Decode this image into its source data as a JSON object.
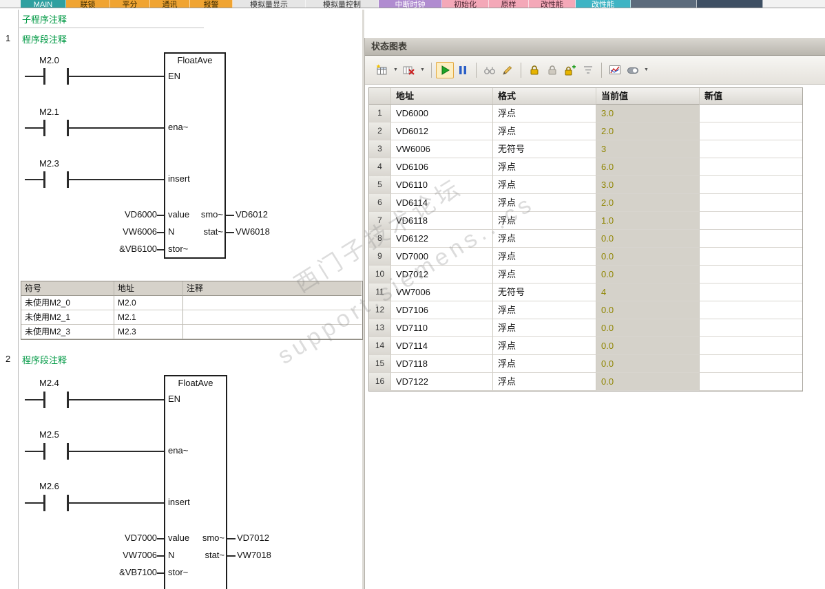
{
  "top_tabs": {
    "items": [
      {
        "label": "MAIN",
        "color": "#2fa0a0"
      },
      {
        "label": "联锁",
        "color": "#f0a432"
      },
      {
        "label": "平分",
        "color": "#f0a432"
      },
      {
        "label": "通讯",
        "color": "#f0a432"
      },
      {
        "label": "报警",
        "color": "#f0a432"
      },
      {
        "label": "模拟量显示",
        "color": "#e6e6e6"
      },
      {
        "label": "模拟量控制",
        "color": "#e6e6e6"
      },
      {
        "label": "中断时钟",
        "color": "#b08cd0"
      },
      {
        "label": "初始化",
        "color": "#f4a8b8"
      },
      {
        "label": "原样",
        "color": "#f4a8b8"
      },
      {
        "label": "改性能",
        "color": "#f4a8b8"
      },
      {
        "label": "改性能",
        "color": "#3fb4c4"
      },
      {
        "label": "",
        "color": "#5c6b7c"
      },
      {
        "label": "",
        "color": "#3e4f63"
      }
    ]
  },
  "editor": {
    "subroutine_comment": "子程序注释",
    "networks": [
      {
        "number": "1",
        "comment": "程序段注释",
        "contacts": [
          "M2.0",
          "M2.1",
          "M2.3"
        ],
        "block": {
          "title": "FloatAve",
          "pin_en": "EN",
          "pin_ena": "ena~",
          "pin_insert": "insert",
          "pin_value": "value",
          "pin_n": "N",
          "pin_stor": "stor~",
          "pin_smo": "smo~",
          "pin_stat": "stat~",
          "op_value": "VD6000",
          "op_n": "VW6006",
          "op_stor": "&VB6100",
          "op_smo": "VD6012",
          "op_stat": "VW6018"
        },
        "symbol_table": {
          "headers": [
            "符号",
            "地址",
            "注释"
          ],
          "rows": [
            {
              "symbol": "未使用M2_0",
              "address": "M2.0",
              "comment": ""
            },
            {
              "symbol": "未使用M2_1",
              "address": "M2.1",
              "comment": ""
            },
            {
              "symbol": "未使用M2_3",
              "address": "M2.3",
              "comment": ""
            }
          ]
        }
      },
      {
        "number": "2",
        "comment": "程序段注释",
        "contacts": [
          "M2.4",
          "M2.5",
          "M2.6"
        ],
        "block": {
          "title": "FloatAve",
          "pin_en": "EN",
          "pin_ena": "ena~",
          "pin_insert": "insert",
          "pin_value": "value",
          "pin_n": "N",
          "pin_stor": "stor~",
          "pin_smo": "smo~",
          "pin_stat": "stat~",
          "op_value": "VD7000",
          "op_n": "VW7006",
          "op_stor": "&VB7100",
          "op_smo": "VD7012",
          "op_stat": "VW7018"
        }
      }
    ]
  },
  "status_chart": {
    "title": "状态图表",
    "toolbar_icons": [
      "new-table",
      "delete-table",
      "start-monitor",
      "pause-monitor",
      "read-all",
      "write-all",
      "force",
      "unforce",
      "force-all",
      "read-force",
      "trend-view",
      "display-toggle"
    ],
    "headers": {
      "address": "地址",
      "format": "格式",
      "current": "当前值",
      "new": "新值"
    },
    "rows": [
      {
        "num": "1",
        "address": "VD6000",
        "format": "浮点",
        "current": "3.0",
        "new": ""
      },
      {
        "num": "2",
        "address": "VD6012",
        "format": "浮点",
        "current": "2.0",
        "new": ""
      },
      {
        "num": "3",
        "address": "VW6006",
        "format": "无符号",
        "current": "3",
        "new": ""
      },
      {
        "num": "4",
        "address": "VD6106",
        "format": "浮点",
        "current": "6.0",
        "new": ""
      },
      {
        "num": "5",
        "address": "VD6110",
        "format": "浮点",
        "current": "3.0",
        "new": ""
      },
      {
        "num": "6",
        "address": "VD6114",
        "format": "浮点",
        "current": "2.0",
        "new": ""
      },
      {
        "num": "7",
        "address": "VD6118",
        "format": "浮点",
        "current": "1.0",
        "new": ""
      },
      {
        "num": "8",
        "address": "VD6122",
        "format": "浮点",
        "current": "0.0",
        "new": ""
      },
      {
        "num": "9",
        "address": "VD7000",
        "format": "浮点",
        "current": "0.0",
        "new": ""
      },
      {
        "num": "10",
        "address": "VD7012",
        "format": "浮点",
        "current": "0.0",
        "new": ""
      },
      {
        "num": "11",
        "address": "VW7006",
        "format": "无符号",
        "current": "4",
        "new": ""
      },
      {
        "num": "12",
        "address": "VD7106",
        "format": "浮点",
        "current": "0.0",
        "new": ""
      },
      {
        "num": "13",
        "address": "VD7110",
        "format": "浮点",
        "current": "0.0",
        "new": ""
      },
      {
        "num": "14",
        "address": "VD7114",
        "format": "浮点",
        "current": "0.0",
        "new": ""
      },
      {
        "num": "15",
        "address": "VD7118",
        "format": "浮点",
        "current": "0.0",
        "new": ""
      },
      {
        "num": "16",
        "address": "VD7122",
        "format": "浮点",
        "current": "0.0",
        "new": ""
      }
    ]
  },
  "watermark": {
    "line1": "西门子技术论坛",
    "line2": "support.siemens...cs"
  },
  "colors": {
    "comment_green": "#009944",
    "current_value_text": "#8f8500",
    "current_value_bg": "#d5d2ca",
    "active_button": "#e3a83e"
  }
}
